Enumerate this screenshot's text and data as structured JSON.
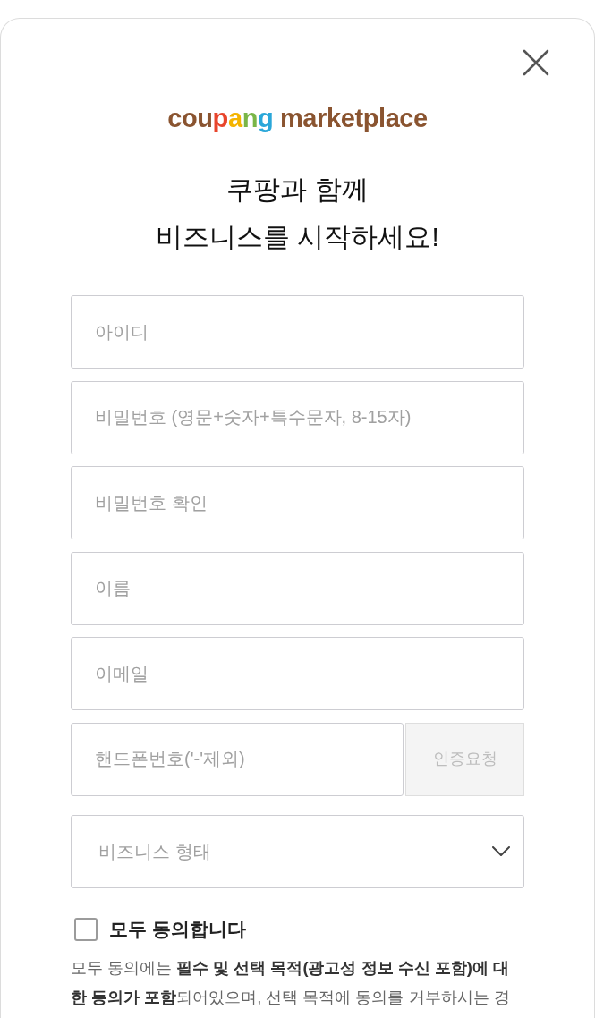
{
  "logo": {
    "brand": "coupang",
    "suffix": "marketplace"
  },
  "headline": [
    "쿠팡과 함께",
    "비즈니스를 시작하세요!"
  ],
  "fields": [
    {
      "placeholder": "아이디"
    },
    {
      "placeholder": "비밀번호 (영문+숫자+특수문자, 8-15자)"
    },
    {
      "placeholder": "비밀번호 확인"
    },
    {
      "placeholder": "이름"
    },
    {
      "placeholder": "이메일"
    }
  ],
  "phone": {
    "placeholder": "핸드폰번호('-'제외)",
    "button": {
      "label": "인증요청",
      "disabled": true
    }
  },
  "business_type": {
    "placeholder": "비즈니스 형태"
  },
  "agree_all": {
    "label": "모두 동의합니다",
    "checked": false
  },
  "notice": "모두 동의에는 **필수 및 선택 목적(광고성 정보 수신 포함)에 대한 동의가 포함**되어있으며, 선택 목적에 동의를 거부하시는 경"
}
